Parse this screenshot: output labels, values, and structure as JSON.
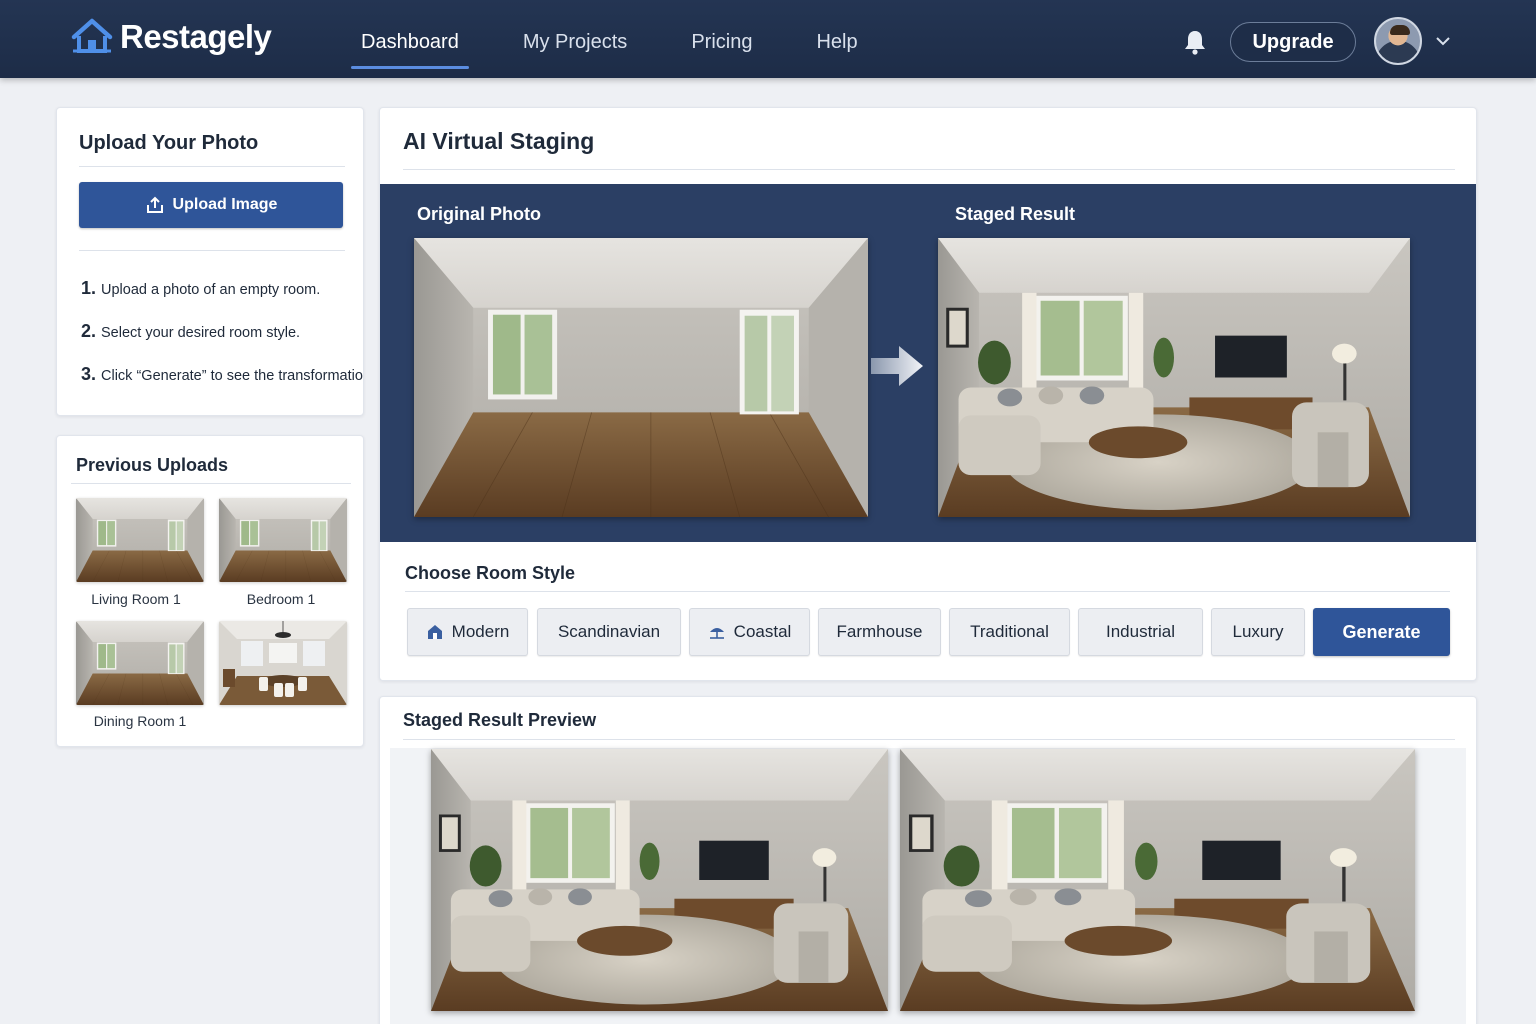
{
  "brand": {
    "name": "Restagely",
    "accent": "#2f5599",
    "nav_bg": "#1d2c47"
  },
  "nav": {
    "items": [
      {
        "label": "Dashboard",
        "active": true
      },
      {
        "label": "My Projects",
        "active": false
      },
      {
        "label": "Pricing",
        "active": false
      },
      {
        "label": "Help",
        "active": false
      }
    ],
    "upgrade_label": "Upgrade",
    "icons": {
      "notifications": "bell-icon",
      "account_menu": "chevron-down-icon"
    }
  },
  "upload": {
    "title": "Upload Your Photo",
    "button_label": "Upload Image",
    "button_icon": "upload-icon",
    "steps": [
      {
        "num": "1.",
        "text": "Upload a photo of an empty room."
      },
      {
        "num": "2.",
        "text": "Select your desired room style."
      },
      {
        "num": "3.",
        "text": "Click “Generate” to see the transformation!"
      }
    ]
  },
  "previous_uploads": {
    "title": "Previous Uploads",
    "items": [
      {
        "label": "Living Room 1"
      },
      {
        "label": "Bedroom 1"
      },
      {
        "label": "Dining Room 1"
      },
      {
        "label": ""
      }
    ]
  },
  "staging": {
    "title": "AI Virtual Staging",
    "original_label": "Original Photo",
    "result_label": "Staged Result",
    "style_title": "Choose Room Style",
    "styles": [
      {
        "label": "Modern",
        "icon": "house-icon"
      },
      {
        "label": "Scandinavian",
        "icon": ""
      },
      {
        "label": "Coastal",
        "icon": "beach-umbrella-icon"
      },
      {
        "label": "Farmhouse",
        "icon": ""
      },
      {
        "label": "Traditional",
        "icon": ""
      },
      {
        "label": "Industrial",
        "icon": ""
      },
      {
        "label": "Luxury",
        "icon": ""
      }
    ],
    "generate_label": "Generate"
  },
  "preview": {
    "title": "Staged Result Preview"
  }
}
